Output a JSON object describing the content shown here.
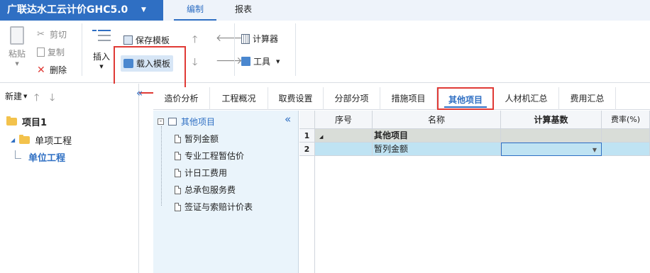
{
  "app": {
    "title": "广联达水工云计价GHC5.0"
  },
  "menu": {
    "tabs": [
      "编制",
      "报表"
    ],
    "active": 0
  },
  "ribbon": {
    "paste": "粘贴",
    "cut": "剪切",
    "copy": "复制",
    "delete": "删除",
    "insert": "插入",
    "save_template": "保存模板",
    "load_template": "载入模板",
    "calculator": "计算器",
    "tools": "工具"
  },
  "left_panel": {
    "new_label": "新建",
    "project": "项目1",
    "single_project": "单项工程",
    "unit_project": "单位工程"
  },
  "tabs": [
    "造价分析",
    "工程概况",
    "取费设置",
    "分部分项",
    "措施项目",
    "其他项目",
    "人材机汇总",
    "费用汇总"
  ],
  "active_tab": 5,
  "other_items_tree": {
    "root": "其他项目",
    "children": [
      "暂列金额",
      "专业工程暂估价",
      "计日工费用",
      "总承包服务费",
      "签证与索赔计价表"
    ]
  },
  "grid": {
    "headers": {
      "seq": "序号",
      "name": "名称",
      "calc_base": "计算基数",
      "rate": "费率(%)"
    },
    "rows": [
      {
        "num": "1",
        "seq": "",
        "name": "其他项目",
        "calc_base": "",
        "rate": ""
      },
      {
        "num": "2",
        "seq": "",
        "name": "暂列金额",
        "calc_base": "",
        "rate": ""
      }
    ]
  },
  "colors": {
    "brand": "#2f6fc3",
    "highlight": "#e03a35",
    "selected_row": "#bfe3f3"
  }
}
